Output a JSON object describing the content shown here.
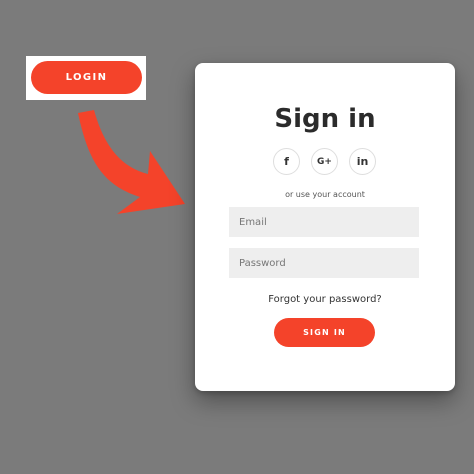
{
  "login_button": {
    "label": "LOGIN"
  },
  "card": {
    "title": "Sign in",
    "social": [
      {
        "label": "f",
        "icon": "facebook-icon"
      },
      {
        "label": "G+",
        "icon": "google-plus-icon"
      },
      {
        "label": "in",
        "icon": "linkedin-icon"
      }
    ],
    "hint": "or use your account",
    "email_placeholder": "Email",
    "password_placeholder": "Password",
    "forgot_label": "Forgot your password?",
    "submit_label": "SIGN IN"
  },
  "colors": {
    "accent": "#f4432a",
    "background": "#7b7b7b"
  }
}
